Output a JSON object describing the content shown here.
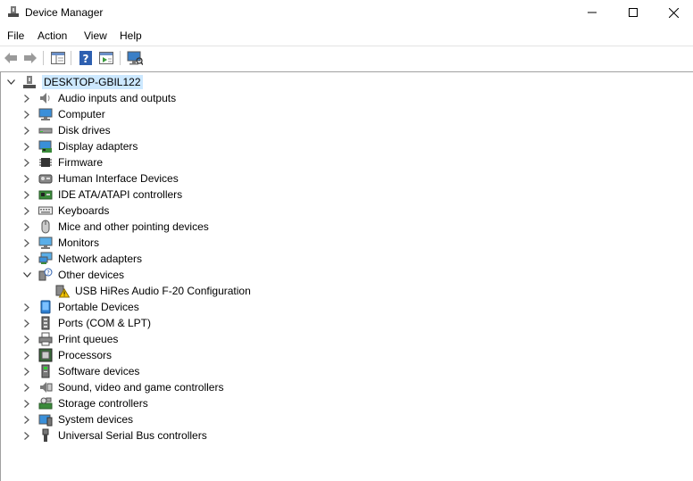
{
  "window": {
    "title": "Device Manager"
  },
  "menu": {
    "file": "File",
    "action": "Action",
    "view": "View",
    "help": "Help"
  },
  "tree": {
    "root": "DESKTOP-GBIL122",
    "categories": [
      {
        "label": "Audio inputs and outputs",
        "icon": "speaker-icon"
      },
      {
        "label": "Computer",
        "icon": "computer-icon"
      },
      {
        "label": "Disk drives",
        "icon": "disk-drive-icon"
      },
      {
        "label": "Display adapters",
        "icon": "display-adapter-icon"
      },
      {
        "label": "Firmware",
        "icon": "firmware-chip-icon"
      },
      {
        "label": "Human Interface Devices",
        "icon": "hid-icon"
      },
      {
        "label": "IDE ATA/ATAPI controllers",
        "icon": "ide-controller-icon"
      },
      {
        "label": "Keyboards",
        "icon": "keyboard-icon"
      },
      {
        "label": "Mice and other pointing devices",
        "icon": "mouse-icon"
      },
      {
        "label": "Monitors",
        "icon": "monitor-icon"
      },
      {
        "label": "Network adapters",
        "icon": "network-adapter-icon"
      },
      {
        "label": "Other devices",
        "icon": "other-devices-icon",
        "expanded": true,
        "children": [
          {
            "label": "USB HiRes Audio F-20 Configuration",
            "icon": "warning-device-icon"
          }
        ]
      },
      {
        "label": "Portable Devices",
        "icon": "portable-device-icon"
      },
      {
        "label": "Ports (COM & LPT)",
        "icon": "port-icon"
      },
      {
        "label": "Print queues",
        "icon": "printer-icon"
      },
      {
        "label": "Processors",
        "icon": "processor-icon"
      },
      {
        "label": "Software devices",
        "icon": "software-device-icon"
      },
      {
        "label": "Sound, video and game controllers",
        "icon": "sound-controller-icon"
      },
      {
        "label": "Storage controllers",
        "icon": "storage-controller-icon"
      },
      {
        "label": "System devices",
        "icon": "system-device-icon"
      },
      {
        "label": "Universal Serial Bus controllers",
        "icon": "usb-icon"
      }
    ]
  }
}
